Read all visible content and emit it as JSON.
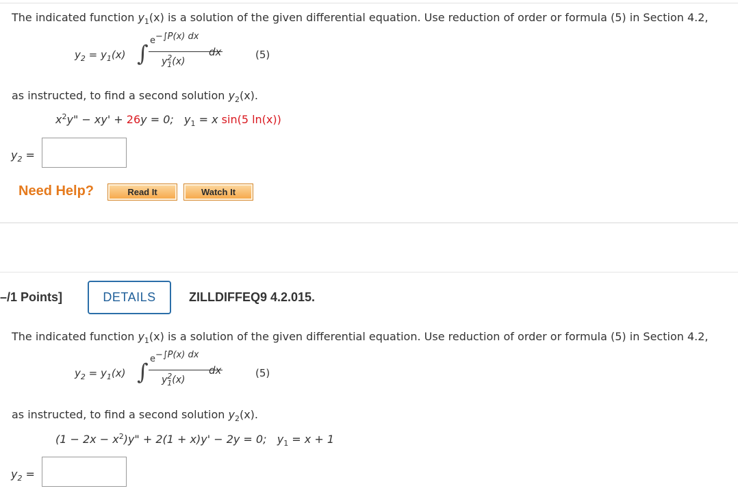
{
  "problem1": {
    "intro": "The indicated function y1(x) is a solution of the given differential equation. Use reduction of order or formula (5) in Section 4.2,",
    "intro_part_a": "The indicated function ",
    "intro_y": "y",
    "intro_sub": "1",
    "intro_part_b": "(x) is a solution of the given differential equation. Use reduction of order or formula (5) in Section 4.2,",
    "formula": {
      "lhs_y2": "y",
      "lhs_sub2": "2",
      "lhs_eq": " = y",
      "lhs_sub1": "1",
      "lhs_x": "(x)",
      "integral": "∫",
      "numerator_e": "e",
      "numerator_exp": "−∫P(x) dx",
      "denominator_y": "y",
      "denominator_sup": "2",
      "denominator_sub": "1",
      "denominator_x": "(x)",
      "dx": "dx",
      "eq_number": "(5)"
    },
    "instruction_a": "as instructed, to find a second solution ",
    "instruction_y": "y",
    "instruction_sub": "2",
    "instruction_b": "(x).",
    "equation": {
      "x": "x",
      "x_sup": "2",
      "part1": "y\" − xy' + ",
      "coef": "26",
      "part2": "y = 0;",
      "y1_label": "y",
      "y1_sub": "1",
      "y1_eq": " = x ",
      "y1_fn": "sin(5 ln(x))"
    },
    "answer_label": "y",
    "answer_sub": "2",
    "answer_eq": " =",
    "answer_value": ""
  },
  "help": {
    "label": "Need Help?",
    "read_it": "Read It",
    "watch_it": "Watch It"
  },
  "problem2": {
    "points": "–/1 Points]",
    "details": "DETAILS",
    "code": "ZILLDIFFEQ9 4.2.015.",
    "intro_part_a": "The indicated function ",
    "intro_y": "y",
    "intro_sub": "1",
    "intro_part_b": "(x) is a solution of the given differential equation. Use reduction of order or formula (5) in Section 4.2,",
    "formula": {
      "lhs_y2": "y",
      "lhs_sub2": "2",
      "lhs_eq": " = y",
      "lhs_sub1": "1",
      "lhs_x": "(x)",
      "integral": "∫",
      "numerator_e": "e",
      "numerator_exp": "−∫P(x) dx",
      "denominator_y": "y",
      "denominator_sup": "2",
      "denominator_sub": "1",
      "denominator_x": "(x)",
      "dx": "dx",
      "eq_number": "(5)"
    },
    "instruction_a": "as instructed, to find a second solution ",
    "instruction_y": "y",
    "instruction_sub": "2",
    "instruction_b": "(x).",
    "equation": {
      "part1": "(1 − 2x − x",
      "sup": "2",
      "part2": ")y\" + 2(1 + x)y' − 2y = 0;",
      "y1_label": "y",
      "y1_sub": "1",
      "y1_eq": " = x + 1"
    },
    "answer_label": "y",
    "answer_sub": "2",
    "answer_eq": " =",
    "answer_value": ""
  },
  "colors": {
    "accent_orange": "#e57a1d",
    "details_blue": "#1f5f99",
    "highlight_red": "#d9181f"
  }
}
